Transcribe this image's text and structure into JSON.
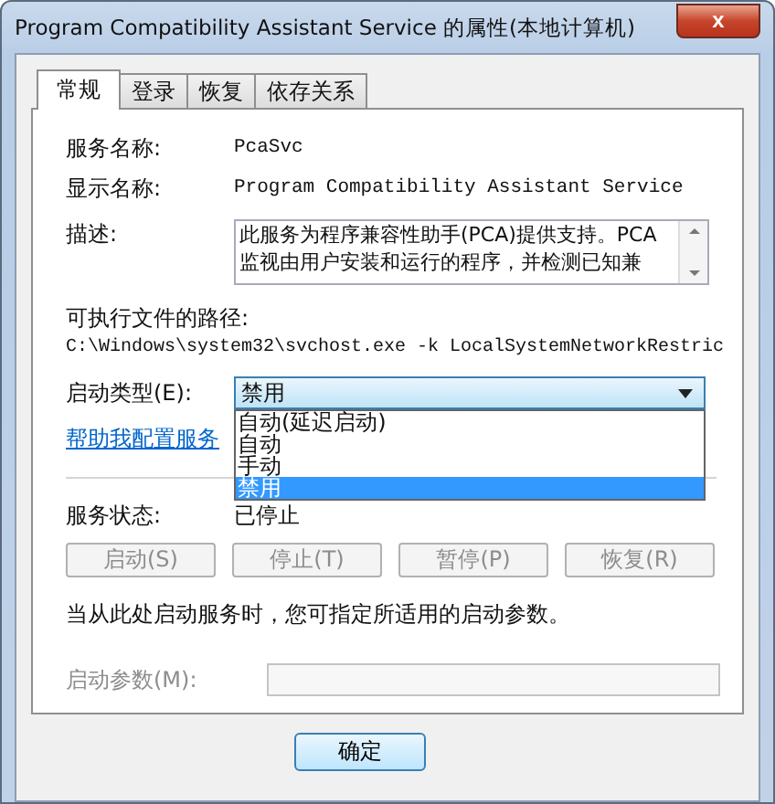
{
  "window": {
    "title": "Program Compatibility Assistant Service 的属性(本地计算机)",
    "close": "x"
  },
  "tabs": [
    {
      "label": "常规",
      "selected": true
    },
    {
      "label": "登录",
      "selected": false
    },
    {
      "label": "恢复",
      "selected": false
    },
    {
      "label": "依存关系",
      "selected": false
    }
  ],
  "service_name": {
    "label": "服务名称:",
    "value": "PcaSvc"
  },
  "display_name": {
    "label": "显示名称:",
    "value": "Program Compatibility Assistant Service"
  },
  "description": {
    "label": "描述:",
    "lines": [
      "此服务为程序兼容性助手(PCA)提供支持。PCA",
      "监视由用户安装和运行的程序，并检测已知兼"
    ]
  },
  "executable_path": {
    "label": "可执行文件的路径:",
    "value": "C:\\Windows\\system32\\svchost.exe -k LocalSystemNetworkRestric"
  },
  "startup_type": {
    "label": "启动类型(E):",
    "value": "禁用",
    "expanded": true,
    "options": [
      {
        "label": "自动(延迟启动)",
        "selected": false
      },
      {
        "label": "自动",
        "selected": false
      },
      {
        "label": "手动",
        "selected": false
      },
      {
        "label": "禁用",
        "selected": true
      }
    ]
  },
  "help_link": "帮助我配置服务",
  "service_status": {
    "label": "服务状态:",
    "value": "已停止"
  },
  "control_buttons": [
    {
      "label": "启动(S)",
      "disabled": true
    },
    {
      "label": "停止(T)",
      "disabled": true
    },
    {
      "label": "暂停(P)",
      "disabled": true
    },
    {
      "label": "恢复(R)",
      "disabled": true
    }
  ],
  "hint": "当从此处启动服务时，您可指定所适用的启动参数。",
  "start_parameters": {
    "label": "启动参数(M):",
    "disabled": true
  },
  "buttons": [
    "确定"
  ]
}
